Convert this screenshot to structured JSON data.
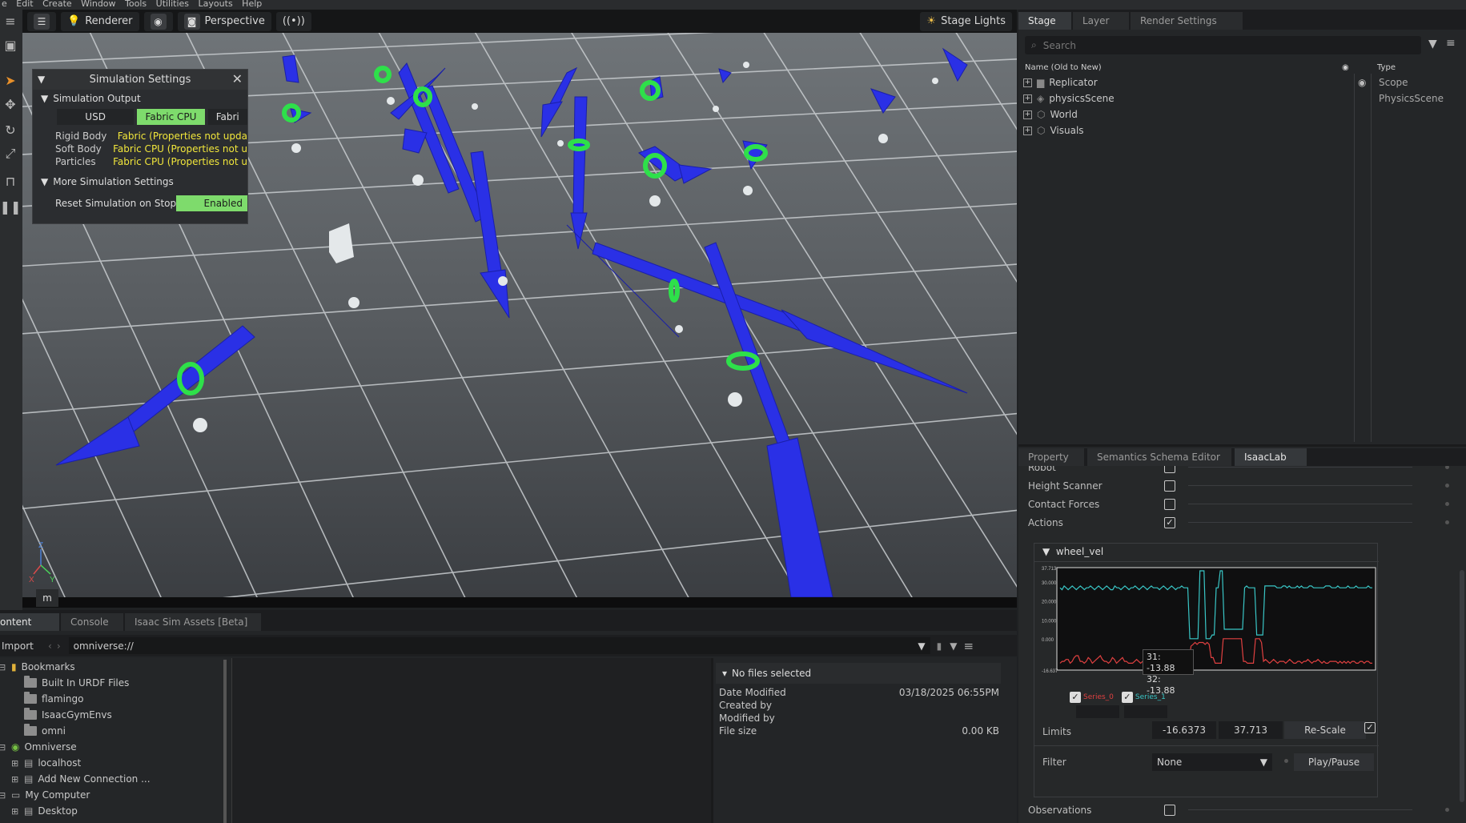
{
  "menubar": {
    "items": [
      "e",
      "Edit",
      "Create",
      "Window",
      "Tools",
      "Utilities",
      "Layouts",
      "Help"
    ]
  },
  "viewport": {
    "toolbar": {
      "renderer": "Renderer",
      "perspective": "Perspective",
      "stage_lights": "Stage Lights"
    },
    "bottom_label": "m",
    "axis_labels": {
      "x": "X",
      "y": "Y",
      "z": "Z"
    }
  },
  "sim_settings": {
    "title": "Simulation Settings",
    "section_output": "Simulation Output",
    "options": [
      "USD",
      "Fabric CPU",
      "Fabri"
    ],
    "selected": "Fabric CPU",
    "rows": [
      {
        "label": "Rigid Body",
        "value": "Fabric (Properties not upda"
      },
      {
        "label": "Soft Body",
        "value": "Fabric CPU (Properties not u"
      },
      {
        "label": "Particles",
        "value": "Fabric CPU (Properties not u"
      }
    ],
    "section_more": "More Simulation Settings",
    "reset_label": "Reset Simulation on Stop",
    "reset_value": "Enabled"
  },
  "stage": {
    "tabs": [
      "Stage",
      "Layer",
      "Render Settings"
    ],
    "active_tab": "Stage",
    "search_placeholder": "Search",
    "col_name": "Name (Old to New)",
    "col_type": "Type",
    "items": [
      {
        "name": "Replicator",
        "type": "Scope"
      },
      {
        "name": "physicsScene",
        "type": "PhysicsScene"
      },
      {
        "name": "World",
        "type": ""
      },
      {
        "name": "Visuals",
        "type": ""
      }
    ]
  },
  "property": {
    "tabs": [
      "Property",
      "Semantics Schema Editor",
      "IsaacLab"
    ],
    "active_tab": "IsaacLab",
    "rows": [
      {
        "label": "Robot",
        "checked": false
      },
      {
        "label": "Height Scanner",
        "checked": false
      },
      {
        "label": "Contact Forces",
        "checked": false
      },
      {
        "label": "Actions",
        "checked": true
      }
    ],
    "group_title": "wheel_vel",
    "tooltip": {
      "line1": "31:  -13.88",
      "line2": "32:  -13.88"
    },
    "legend": [
      {
        "name": "Series_0",
        "color": "#e04040",
        "checked": true
      },
      {
        "name": "Series_1",
        "color": "#39c6c6",
        "checked": true
      }
    ],
    "limits_label": "Limits",
    "limit_min": "-16.6373",
    "limit_max": "37.713",
    "rescale": "Re-Scale",
    "rescale_checked": true,
    "filter_label": "Filter",
    "filter_value": "None",
    "play_pause": "Play/Pause",
    "observations_label": "Observations",
    "observations_checked": false
  },
  "chart_data": {
    "type": "line",
    "title": "",
    "ylim": [
      -16.637,
      37.713
    ],
    "ytick_labels": [
      "37.713",
      "30.000",
      "20.000",
      "10.000",
      "0.000",
      "-16.637"
    ],
    "yticks": [
      37.713,
      30,
      20,
      10,
      0,
      -16.637
    ],
    "series": [
      {
        "name": "Series_1",
        "color": "#39c6c6",
        "values": [
          27,
          26,
          28,
          27,
          26,
          27,
          28,
          27,
          26,
          27,
          28,
          27,
          26,
          27,
          27,
          28,
          27,
          26,
          27,
          28,
          27,
          26,
          27,
          28,
          27,
          26,
          26,
          28,
          27,
          27,
          26,
          27,
          28,
          27,
          26,
          27,
          27,
          28,
          27,
          26,
          27,
          28,
          27,
          26,
          27,
          28,
          27,
          27,
          27,
          26,
          27,
          28,
          27,
          26,
          27,
          28,
          27,
          26,
          27,
          27,
          28,
          27,
          27,
          27,
          0,
          0,
          0,
          0,
          0,
          36,
          36,
          36,
          0,
          0,
          0,
          2,
          2,
          27,
          27,
          36,
          36,
          5,
          5,
          5,
          5,
          5,
          5,
          5,
          5,
          5,
          5,
          27,
          28,
          27,
          27,
          27,
          27,
          2,
          2,
          2,
          2,
          28,
          28,
          28,
          28,
          28,
          28,
          27,
          27,
          27,
          28,
          28,
          27,
          28,
          27,
          27,
          27,
          28,
          27,
          28,
          27,
          27,
          27,
          28,
          28,
          27,
          27,
          27,
          27,
          27,
          27,
          28,
          28,
          28,
          27,
          27,
          27,
          28,
          27,
          27,
          27,
          27,
          28,
          27,
          27,
          27,
          28,
          27,
          27,
          27,
          27,
          27,
          28,
          27,
          27
        ]
      },
      {
        "name": "Series_0",
        "color": "#e04040",
        "values": [
          -13,
          -12,
          -12,
          -11,
          -11,
          -13,
          -12,
          -10,
          -9,
          -9,
          -12,
          -12,
          -13,
          -12,
          -10,
          -11,
          -13,
          -12,
          -11,
          -10,
          -9,
          -11,
          -12,
          -12,
          -13,
          -12,
          -10,
          -11,
          -13,
          -12,
          -11,
          -10,
          -12,
          -12,
          -13,
          -13,
          -13,
          -12,
          -11,
          -12,
          -13,
          -12,
          -11,
          -12,
          -13,
          -12,
          -11,
          -11,
          -13,
          -13,
          -12,
          -12,
          -11,
          -13,
          -12,
          -12,
          -13,
          -12,
          -11,
          -12,
          -13,
          -13,
          -13,
          -13,
          -13,
          -4,
          -3,
          -2,
          -3,
          -2,
          -2,
          -2,
          -3,
          -2,
          -3,
          -10,
          -10,
          -13,
          -13,
          -13,
          -13,
          0,
          0,
          0,
          0,
          0,
          0,
          0,
          0,
          0,
          0,
          -12,
          -12,
          -13,
          -13,
          -13,
          -13,
          0,
          0,
          0,
          -2,
          -12,
          -11,
          -12,
          -13,
          -12,
          -11,
          -12,
          -13,
          -12,
          -12,
          -12,
          -13,
          -12,
          -11,
          -12,
          -13,
          -13,
          -12,
          -12,
          -13,
          -12,
          -12,
          -11,
          -12,
          -13,
          -12,
          -12,
          -11,
          -12,
          -13,
          -12,
          -13,
          -13,
          -12,
          -12,
          -12,
          -12,
          -13,
          -12,
          -13,
          -12,
          -13,
          -12,
          -13,
          -12,
          -12,
          -13,
          -13,
          -12,
          -12,
          -13,
          -12,
          -12,
          -13,
          -13
        ]
      }
    ]
  },
  "content": {
    "tabs": [
      "ontent",
      "Console",
      "Isaac Sim Assets [Beta]"
    ],
    "active_tab": "ontent",
    "import_label": "Import",
    "path": "omniverse://",
    "tree": [
      {
        "label": "Bookmarks",
        "indent": 0,
        "kind": "bookmark"
      },
      {
        "label": "Built In URDF Files",
        "indent": 1,
        "kind": "folder"
      },
      {
        "label": "flamingo",
        "indent": 1,
        "kind": "folder"
      },
      {
        "label": "IsaacGymEnvs",
        "indent": 1,
        "kind": "folder"
      },
      {
        "label": "omni",
        "indent": 1,
        "kind": "folder"
      },
      {
        "label": "Omniverse",
        "indent": 0,
        "kind": "omniverse"
      },
      {
        "label": "localhost",
        "indent": 1,
        "kind": "server"
      },
      {
        "label": "Add New Connection ...",
        "indent": 1,
        "kind": "server"
      },
      {
        "label": "My Computer",
        "indent": 0,
        "kind": "computer"
      },
      {
        "label": "Desktop",
        "indent": 1,
        "kind": "server"
      }
    ],
    "details_title": "No files selected",
    "details": [
      {
        "label": "Date Modified",
        "value": "03/18/2025 06:55PM"
      },
      {
        "label": "Created by",
        "value": ""
      },
      {
        "label": "Modified by",
        "value": ""
      },
      {
        "label": "File size",
        "value": "0.00 KB"
      }
    ]
  }
}
